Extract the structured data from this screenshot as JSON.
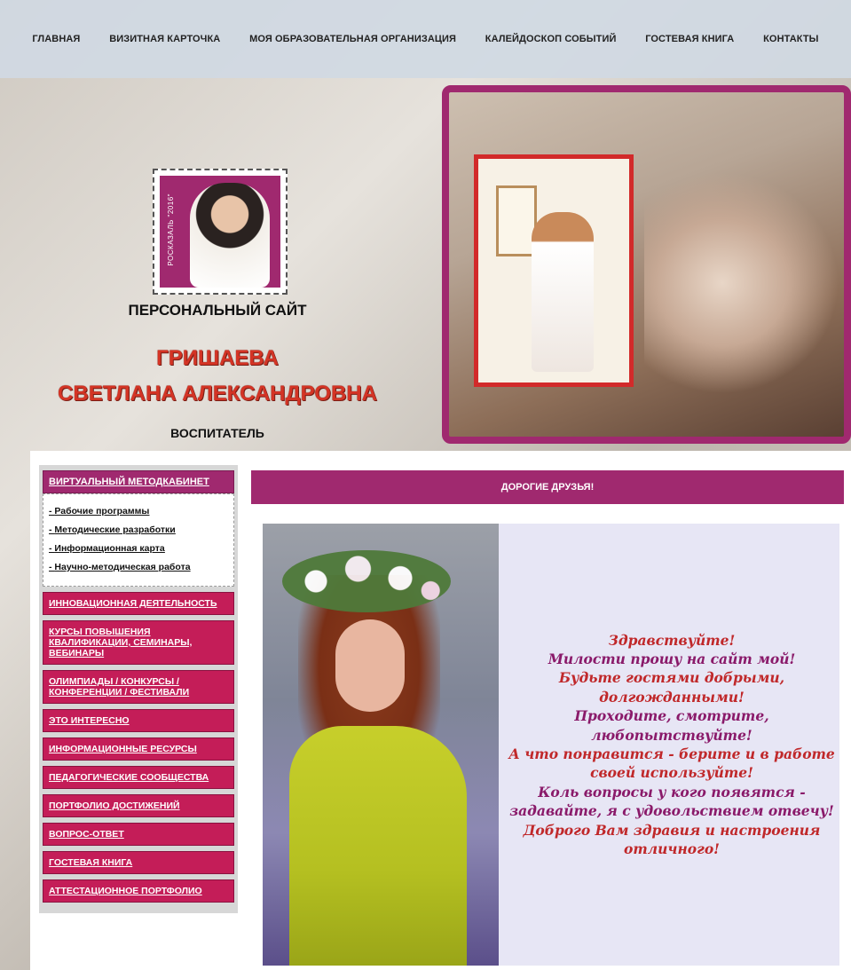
{
  "nav": {
    "items": [
      "ГЛАВНАЯ",
      "ВИЗИТНАЯ КАРТОЧКА",
      "МОЯ ОБРАЗОВАТЕЛЬНАЯ ОРГАНИЗАЦИЯ",
      "КАЛЕЙДОСКОП СОБЫТИЙ",
      "ГОСТЕВАЯ КНИГА",
      "КОНТАКТЫ"
    ]
  },
  "header": {
    "stamp_text": "РОСКАЗАЛЬ \"2016\"",
    "site_label": "ПЕРСОНАЛЬНЫЙ САЙТ",
    "name_line1": "ГРИШАЕВА",
    "name_line2": "СВЕТЛАНА АЛЕКСАНДРОВНА",
    "role": "ВОСПИТАТЕЛЬ",
    "icons": [
      "mail-icon",
      "glasses-icon",
      "search-icon",
      "lock-icon"
    ]
  },
  "sidebar": {
    "head": "ВИРТУАЛЬНЫЙ МЕТОДКАБИНЕТ",
    "sub_items": [
      "Рабочие программы",
      "Методические разработки",
      "Информационная карта",
      "Научно-методическая работа"
    ],
    "items": [
      "ИННОВАЦИОННАЯ ДЕЯТЕЛЬНОСТЬ",
      "КУРСЫ ПОВЫШЕНИЯ КВАЛИФИКАЦИИ, СЕМИНАРЫ, ВЕБИНАРЫ",
      "ОЛИМПИАДЫ / КОНКУРСЫ / КОНФЕРЕНЦИИ / ФЕСТИВАЛИ",
      "ЭТО ИНТЕРЕСНО",
      "ИНФОРМАЦИОННЫЕ РЕСУРСЫ",
      "ПЕДАГОГИЧЕСКИЕ СООБЩЕСТВА",
      "ПОРТФОЛИО ДОСТИЖЕНИЙ",
      "ВОПРОС-ОТВЕТ",
      "ГОСТЕВАЯ КНИГА",
      "АТТЕСТАЦИОННОЕ ПОРТФОЛИО"
    ]
  },
  "main": {
    "bar_title": "ДОРОГИЕ ДРУЗЬЯ!",
    "greeting": [
      "Здравствуйте!",
      "Милости прошу на сайт мой!",
      "Будьте гостями добрыми,",
      "долгожданными!",
      "Проходите, смотрите,",
      "любопытствуйте!",
      "А что понравится - берите и в работе",
      "своей используйте!",
      "Коль вопросы у кого появятся -",
      "задавайте, я с удовольствием отвечу!",
      "Доброго Вам здравия и настроения",
      "отличного!"
    ]
  },
  "colors": {
    "accent": "#a0296f",
    "menu": "#c41d58",
    "name": "#d43425",
    "greeting_red": "#c0282a",
    "greeting_purple": "#8a1a6a"
  }
}
